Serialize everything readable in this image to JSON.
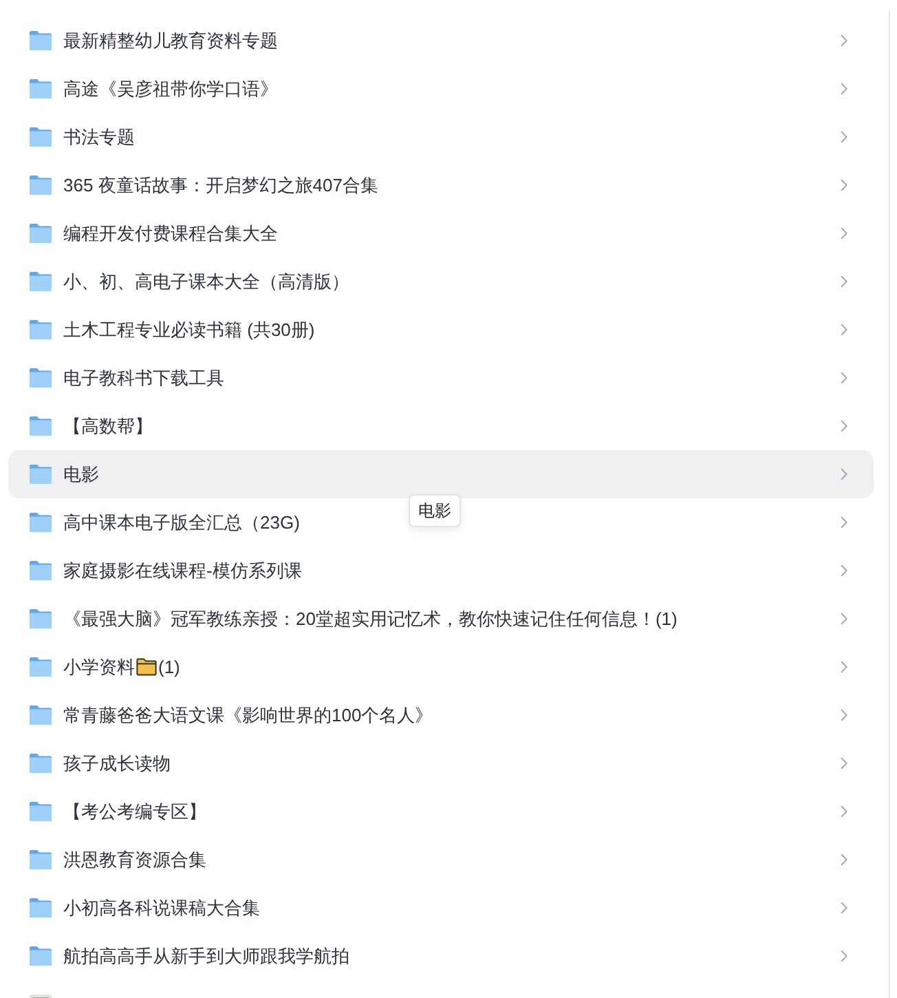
{
  "list": {
    "rows": [
      {
        "kind": "folder",
        "label": "最新精整幼儿教育资料专题",
        "hovered": false
      },
      {
        "kind": "folder",
        "label": "高途《吴彦祖带你学口语》",
        "hovered": false
      },
      {
        "kind": "folder",
        "label": "书法专题",
        "hovered": false
      },
      {
        "kind": "folder",
        "label": "365 夜童话故事：开启梦幻之旅407合集",
        "hovered": false
      },
      {
        "kind": "folder",
        "label": "编程开发付费课程合集大全",
        "hovered": false
      },
      {
        "kind": "folder",
        "label": "小、初、高电子课本大全（高清版）",
        "hovered": false
      },
      {
        "kind": "folder",
        "label": "土木工程专业必读书籍 (共30册)",
        "hovered": false
      },
      {
        "kind": "folder",
        "label": "电子教科书下载工具",
        "hovered": false
      },
      {
        "kind": "folder",
        "label": "【高数帮】",
        "hovered": false
      },
      {
        "kind": "folder",
        "label": "电影",
        "hovered": true
      },
      {
        "kind": "folder",
        "label": "高中课本电子版全汇总（23G)",
        "hovered": false
      },
      {
        "kind": "folder",
        "label": "家庭摄影在线课程-模仿系列课",
        "hovered": false
      },
      {
        "kind": "folder",
        "label": "《最强大脑》冠军教练亲授：20堂超实用记忆术，教你快速记住任何信息！(1)",
        "hovered": false
      },
      {
        "kind": "folder",
        "label": "小学资料",
        "folder_emoji": true,
        "label_suffix": "(1)",
        "hovered": false
      },
      {
        "kind": "folder",
        "label": "常青藤爸爸大语文课《影响世界的100个名人》",
        "hovered": false
      },
      {
        "kind": "folder",
        "label": "孩子成长读物",
        "hovered": false
      },
      {
        "kind": "folder",
        "label": "【考公考编专区】",
        "hovered": false
      },
      {
        "kind": "folder",
        "label": "洪恩教育资源合集",
        "hovered": false
      },
      {
        "kind": "folder",
        "label": "小初高各科说课稿大合集",
        "hovered": false
      },
      {
        "kind": "folder",
        "label": "航拍高高手从新手到大师跟我学航拍",
        "hovered": false
      },
      {
        "kind": "file",
        "hovered": false
      }
    ]
  },
  "tooltip": {
    "text": "电影"
  }
}
